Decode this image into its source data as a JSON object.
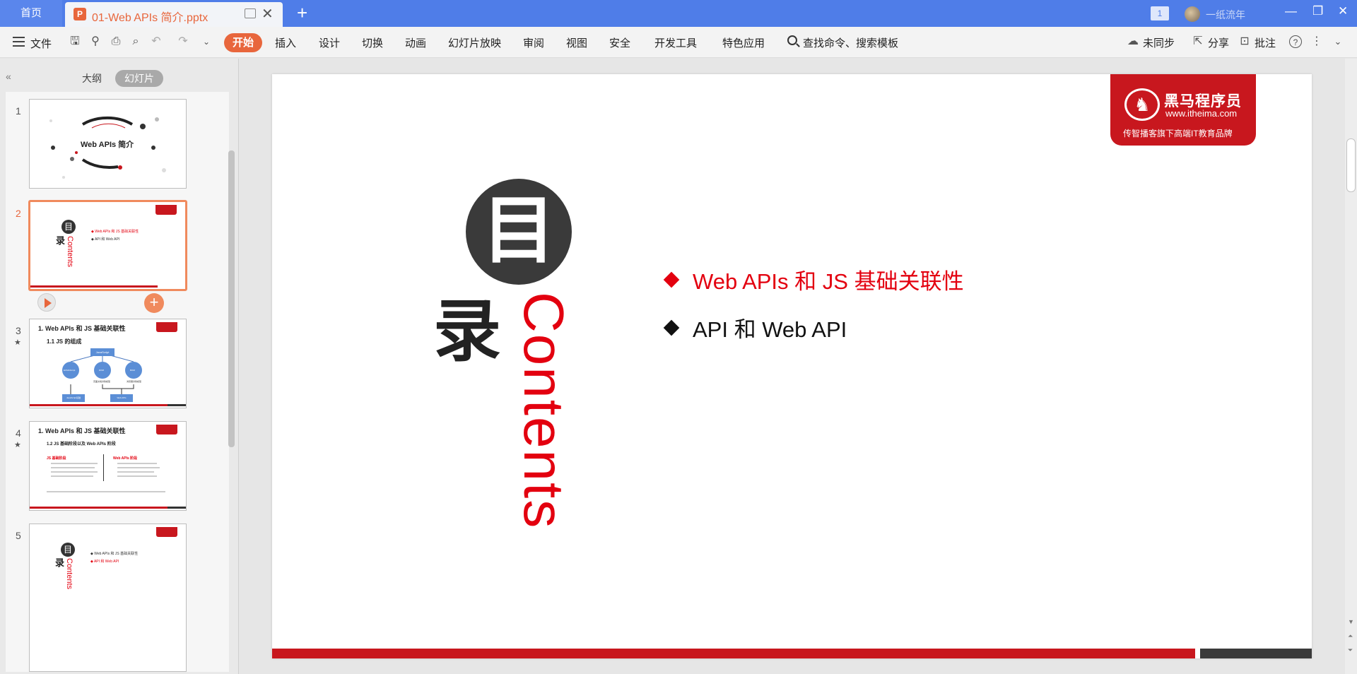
{
  "titlebar": {
    "home_tab": "首页",
    "doc_tab_title": "01-Web APIs 简介.pptx",
    "page_badge": "1",
    "user_name": "一纸流年"
  },
  "ribbon": {
    "file_label": "文件",
    "tabs": [
      "开始",
      "插入",
      "设计",
      "切换",
      "动画",
      "幻灯片放映",
      "审阅",
      "视图",
      "安全",
      "开发工具",
      "特色应用"
    ],
    "search_label": "查找命令、搜索模板",
    "sync_label": "未同步",
    "share_label": "分享",
    "comment_label": "批注"
  },
  "left_panel": {
    "tab_outline": "大纲",
    "tab_slides": "幻灯片",
    "slide_numbers": [
      "1",
      "2",
      "3",
      "4",
      "5"
    ],
    "thumb1_title": "Web APIs 简介",
    "thumb2": {
      "mu": "目",
      "lu": "录",
      "contents": "Contents",
      "item1": "Web APIs 和 JS 基础关联性",
      "item2": "API 和 Web API"
    },
    "thumb3": {
      "title": "1. Web APIs 和 JS 基础关联性",
      "subtitle": "1.1 JS 的组成",
      "top_box": "JavaScript",
      "circle1": "ECMAScript",
      "circle2": "DOM",
      "circle3": "BOM",
      "box_left": "JavaScript基础",
      "box_right": "Web APIs",
      "note1": "页面文档对象模型",
      "note2": "浏览器对象模型"
    },
    "thumb4": {
      "title": "1. Web APIs 和 JS 基础关联性",
      "subtitle": "1.2 JS 基础阶段以及 Web APIs 阶段",
      "col_left": "JS 基础阶段",
      "col_right": "Web APIs 阶段"
    },
    "thumb5": {
      "mu": "目",
      "lu": "录",
      "contents": "Contents",
      "item1": "Web APIs 和 JS 基础关联性",
      "item2": "API 和 Web API"
    }
  },
  "slide": {
    "logo_name": "黑马程序员",
    "logo_url": "www.itheima.com",
    "logo_slogan": "传智播客旗下高端IT教育品牌",
    "mu_char": "目",
    "lu_char": "录",
    "contents_text": "Contents",
    "bullets": [
      {
        "text": "Web APIs 和 JS 基础关联性",
        "color": "#e3000f"
      },
      {
        "text": "API 和 Web API",
        "color": "#111111"
      }
    ]
  },
  "colors": {
    "titlebar": "#4f7de8",
    "accent_orange": "#e8663c",
    "brand_red": "#c8171e",
    "contents_red": "#e3000f",
    "dark_circle": "#3a3a3a"
  },
  "icons": [
    "ppt-file-icon",
    "monitor-icon",
    "close-icon",
    "plus-icon",
    "minimize-icon",
    "restore-icon",
    "window-close-icon",
    "hamburger-menu-icon",
    "save-icon",
    "format-painter-icon",
    "print-icon",
    "print-preview-icon",
    "undo-icon",
    "redo-icon",
    "chevron-down-icon",
    "search-icon",
    "cloud-sync-icon",
    "share-icon",
    "comment-icon",
    "help-icon",
    "more-icon",
    "collapse-icon",
    "play-icon",
    "add-slide-icon",
    "star-icon"
  ]
}
